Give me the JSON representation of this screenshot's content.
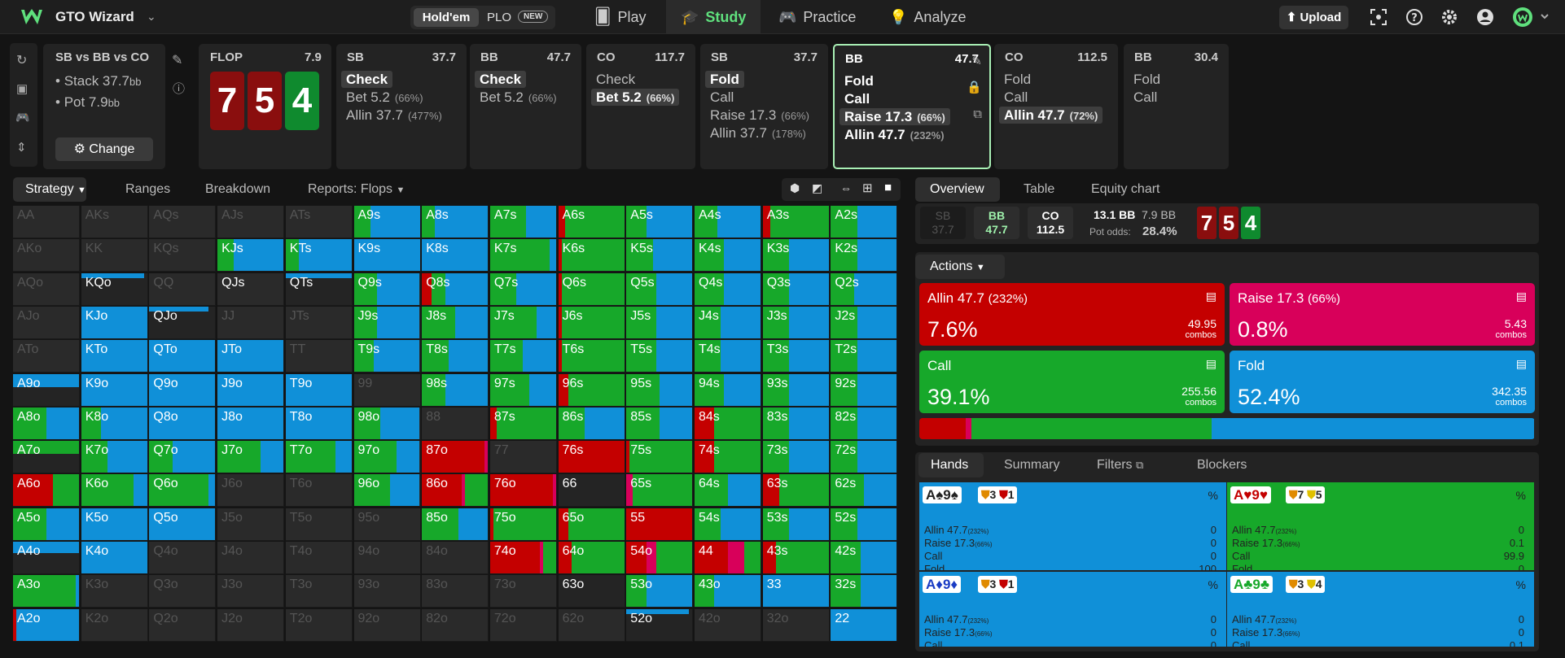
{
  "app": {
    "title": "GTO Wizard",
    "game_toggle": [
      "Hold'em",
      "PLO"
    ],
    "new_badge": "NEW",
    "nav": [
      "Play",
      "Study",
      "Practice",
      "Analyze"
    ],
    "upload": "Upload",
    "accent": "#5fe07d"
  },
  "spot": {
    "title": "SB vs BB vs CO",
    "stack_label": "Stack 37.7",
    "stack_unit": "bb",
    "pot_label": "Pot 7.9",
    "pot_unit": "bb",
    "change": "Change"
  },
  "board": {
    "street": "FLOP",
    "pot": "7.9",
    "cards": [
      "7",
      "5",
      "4"
    ]
  },
  "actions_history": [
    {
      "pos": "SB",
      "val": "37.7",
      "acts": [
        {
          "t": "Check",
          "sel": true
        },
        {
          "t": "Bet 5.2",
          "p": "(66%)"
        },
        {
          "t": "Allin 37.7",
          "p": "(477%)"
        }
      ]
    },
    {
      "pos": "BB",
      "val": "47.7",
      "acts": [
        {
          "t": "Check",
          "sel": true
        },
        {
          "t": "Bet 5.2",
          "p": "(66%)"
        }
      ]
    },
    {
      "pos": "CO",
      "val": "117.7",
      "acts": [
        {
          "t": "Check"
        },
        {
          "t": "Bet 5.2",
          "p": "(66%)",
          "sel": true
        }
      ]
    },
    {
      "pos": "SB",
      "val": "37.7",
      "acts": [
        {
          "t": "Fold",
          "sel": true
        },
        {
          "t": "Call"
        },
        {
          "t": "Raise 17.3",
          "p": "(66%)"
        },
        {
          "t": "Allin 37.7",
          "p": "(178%)"
        }
      ]
    },
    {
      "pos": "BB",
      "val": "47.7",
      "acts": [
        {
          "t": "Fold"
        },
        {
          "t": "Call"
        },
        {
          "t": "Raise 17.3",
          "p": "(66%)",
          "sel": true
        },
        {
          "t": "Allin 47.7",
          "p": "(232%)"
        }
      ]
    },
    {
      "pos": "CO",
      "val": "112.5",
      "acts": [
        {
          "t": "Fold"
        },
        {
          "t": "Call"
        },
        {
          "t": "Allin 47.7",
          "p": "(72%)",
          "sel": true
        }
      ]
    },
    {
      "pos": "BB",
      "val": "30.4",
      "acts": [
        {
          "t": "Fold"
        },
        {
          "t": "Call"
        }
      ]
    }
  ],
  "strategy_tabs": [
    "Strategy",
    "Ranges",
    "Breakdown",
    "Reports: Flops"
  ],
  "right_tabs": [
    "Overview",
    "Table",
    "Equity chart"
  ],
  "overview": {
    "players": [
      {
        "p": "SB",
        "v": "37.7"
      },
      {
        "p": "BB",
        "v": "47.7"
      },
      {
        "p": "CO",
        "v": "112.5"
      }
    ],
    "pot": "13.1 BB",
    "call": "7.9 BB",
    "pot_odds_label": "Pot odds:",
    "pot_odds": "28.4%",
    "board": [
      "7",
      "5",
      "4"
    ]
  },
  "actions_label": "Actions",
  "action_boxes": [
    {
      "label": "Allin 47.7",
      "pct_label": "(232%)",
      "freq": "7.6%",
      "combos": "49.95",
      "unit": "combos",
      "color": "#c40000"
    },
    {
      "label": "Raise 17.3",
      "pct_label": "(66%)",
      "freq": "0.8%",
      "combos": "5.43",
      "unit": "combos",
      "color": "#d8005a"
    },
    {
      "label": "Call",
      "pct_label": "",
      "freq": "39.1%",
      "combos": "255.56",
      "unit": "combos",
      "color": "#17a82a"
    },
    {
      "label": "Fold",
      "pct_label": "",
      "freq": "52.4%",
      "combos": "342.35",
      "unit": "combos",
      "color": "#1090d8"
    }
  ],
  "freq_bar": [
    7.6,
    0.8,
    39.1,
    52.4
  ],
  "hand_tabs": [
    "Hands",
    "Summary",
    "Filters",
    "Blockers"
  ],
  "hand_cards": [
    {
      "hand": "A♠9♠",
      "c1": "3",
      "c2": "1",
      "rows": [
        [
          "Allin 47.7",
          "(232%)",
          "0"
        ],
        [
          "Raise 17.3",
          "(66%)",
          "0"
        ],
        [
          "Call",
          "",
          "0"
        ],
        [
          "Fold",
          "",
          "100"
        ]
      ],
      "color": "#1090d8"
    },
    {
      "hand": "A♥9♥",
      "c1": "7",
      "c2": "5",
      "rows": [
        [
          "Allin 47.7",
          "(232%)",
          "0"
        ],
        [
          "Raise 17.3",
          "(66%)",
          "0.1"
        ],
        [
          "Call",
          "",
          "99.9"
        ],
        [
          "Fold",
          "",
          "0"
        ]
      ],
      "color": "#17a82a"
    },
    {
      "hand": "A♦9♦",
      "c1": "3",
      "c2": "1",
      "rows": [
        [
          "Allin 47.7",
          "(232%)",
          "0"
        ],
        [
          "Raise 17.3",
          "(66%)",
          "0"
        ],
        [
          "Call",
          "",
          "0"
        ]
      ],
      "color": "#1090d8"
    },
    {
      "hand": "A♣9♣",
      "c1": "3",
      "c2": "4",
      "rows": [
        [
          "Allin 47.7",
          "(232%)",
          "0"
        ],
        [
          "Raise 17.3",
          "(66%)",
          "0"
        ],
        [
          "Call",
          "",
          "0.1"
        ]
      ],
      "color": "#1090d8"
    }
  ],
  "matrix": [
    [
      "AA",
      "AKs",
      "AQs",
      "AJs",
      "ATs",
      "A9s",
      "A8s",
      "A7s",
      "A6s",
      "A5s",
      "A4s",
      "A3s",
      "A2s"
    ],
    [
      "AKo",
      "KK",
      "KQs",
      "KJs",
      "KTs",
      "K9s",
      "K8s",
      "K7s",
      "K6s",
      "K5s",
      "K4s",
      "K3s",
      "K2s"
    ],
    [
      "AQo",
      "KQo",
      "QQ",
      "QJs",
      "QTs",
      "Q9s",
      "Q8s",
      "Q7s",
      "Q6s",
      "Q5s",
      "Q4s",
      "Q3s",
      "Q2s"
    ],
    [
      "AJo",
      "KJo",
      "QJo",
      "JJ",
      "JTs",
      "J9s",
      "J8s",
      "J7s",
      "J6s",
      "J5s",
      "J4s",
      "J3s",
      "J2s"
    ],
    [
      "ATo",
      "KTo",
      "QTo",
      "JTo",
      "TT",
      "T9s",
      "T8s",
      "T7s",
      "T6s",
      "T5s",
      "T4s",
      "T3s",
      "T2s"
    ],
    [
      "A9o",
      "K9o",
      "Q9o",
      "J9o",
      "T9o",
      "99",
      "98s",
      "97s",
      "96s",
      "95s",
      "94s",
      "93s",
      "92s"
    ],
    [
      "A8o",
      "K8o",
      "Q8o",
      "J8o",
      "T8o",
      "98o",
      "88",
      "87s",
      "86s",
      "85s",
      "84s",
      "83s",
      "82s"
    ],
    [
      "A7o",
      "K7o",
      "Q7o",
      "J7o",
      "T7o",
      "97o",
      "87o",
      "77",
      "76s",
      "75s",
      "74s",
      "73s",
      "72s"
    ],
    [
      "A6o",
      "K6o",
      "Q6o",
      "J6o",
      "T6o",
      "96o",
      "86o",
      "76o",
      "66",
      "65s",
      "64s",
      "63s",
      "62s"
    ],
    [
      "A5o",
      "K5o",
      "Q5o",
      "J5o",
      "T5o",
      "95o",
      "85o",
      "75o",
      "65o",
      "55",
      "54s",
      "53s",
      "52s"
    ],
    [
      "A4o",
      "K4o",
      "Q4o",
      "J4o",
      "T4o",
      "94o",
      "84o",
      "74o",
      "64o",
      "54o",
      "44",
      "43s",
      "42s"
    ],
    [
      "A3o",
      "K3o",
      "Q3o",
      "J3o",
      "T3o",
      "93o",
      "83o",
      "73o",
      "63o",
      "53o",
      "43o",
      "33",
      "32s"
    ],
    [
      "A2o",
      "K2o",
      "Q2o",
      "J2o",
      "T2o",
      "92o",
      "82o",
      "72o",
      "62o",
      "52o",
      "42o",
      "32o",
      "22"
    ]
  ]
}
